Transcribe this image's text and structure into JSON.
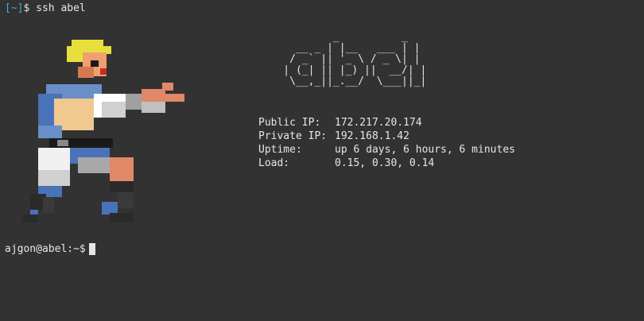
{
  "terminal": {
    "command_prompt_dir": "[~]",
    "command_prompt_symbol": "$",
    "command": "ssh abel",
    "ascii_art_text": "abel",
    "ascii_logo_lines": [
      "            _          _ ",
      "      __ _ | |__   ___ | |",
      "     / _` || '_ \\ / _ \\| |",
      "    | (_| || |_) ||  __/| |",
      "     \\__,_||_.__/  \\___||_|"
    ],
    "info": [
      {
        "label": "Public IP:",
        "value": "172.217.20.174"
      },
      {
        "label": "Private IP:",
        "value": "192.168.1.42"
      },
      {
        "label": "Uptime:",
        "value": "up 6 days, 6 hours, 6 minutes"
      },
      {
        "label": "Load:",
        "value": "0.15, 0.30, 0.14"
      }
    ],
    "shell_prompt": "ajgon@abel:~$",
    "sprite_icon": "pixel-fighter-icon"
  }
}
